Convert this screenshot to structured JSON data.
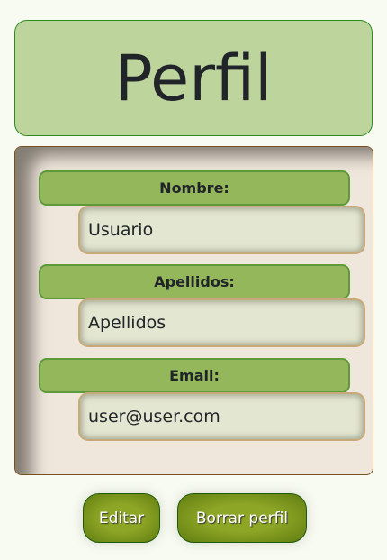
{
  "title": "Perfil",
  "fields": [
    {
      "label": "Nombre:",
      "value": "Usuario"
    },
    {
      "label": "Apellidos:",
      "value": "Apellidos"
    },
    {
      "label": "Email:",
      "value": "user@user.com"
    }
  ],
  "buttons": {
    "edit": "Editar",
    "delete": "Borrar perfil"
  }
}
